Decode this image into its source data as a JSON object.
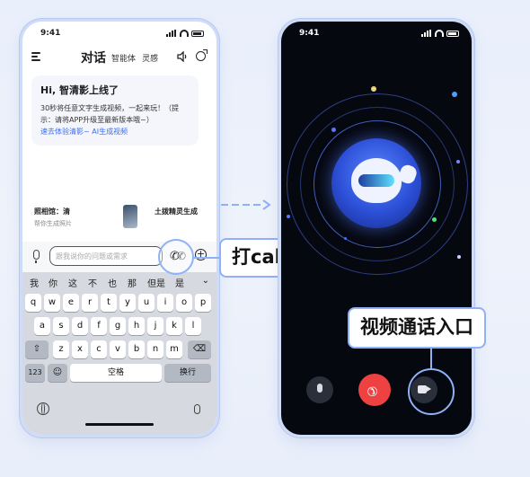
{
  "left_phone": {
    "status_time": "9:41",
    "tabs": [
      "对话",
      "智能体",
      "灵感"
    ],
    "greeting": {
      "title": "Hi, 智清影上线了",
      "body": "30秒将任意文字生成视频，一起来玩！（提示：请将APP升级至最新版本哦~）",
      "link": "速去体验清影~ AI生成视频"
    },
    "cards": [
      {
        "title": "照相馆：清",
        "sub": "帮你生成照片"
      },
      {
        "title": "土拨精灵生成",
        "sub": ""
      }
    ],
    "input_placeholder": "跟我说你的问题或需求",
    "keyboard": {
      "candidates": [
        "我",
        "你",
        "这",
        "不",
        "也",
        "那",
        "但是",
        "是"
      ],
      "row1": [
        "q",
        "w",
        "e",
        "r",
        "t",
        "y",
        "u",
        "i",
        "o",
        "p"
      ],
      "row2": [
        "a",
        "s",
        "d",
        "f",
        "g",
        "h",
        "j",
        "k",
        "l"
      ],
      "row3": [
        "z",
        "x",
        "c",
        "v",
        "b",
        "n",
        "m"
      ],
      "num_key": "123",
      "space_key": "空格",
      "return_key": "换行"
    }
  },
  "right_phone": {
    "status_time": "9:41"
  },
  "callouts": {
    "call_entry": "打call入口",
    "video_entry": "视频通话入口"
  },
  "colors": {
    "accent": "#8fb1f7",
    "hangup": "#ee4141",
    "call_bg": "#060810"
  }
}
